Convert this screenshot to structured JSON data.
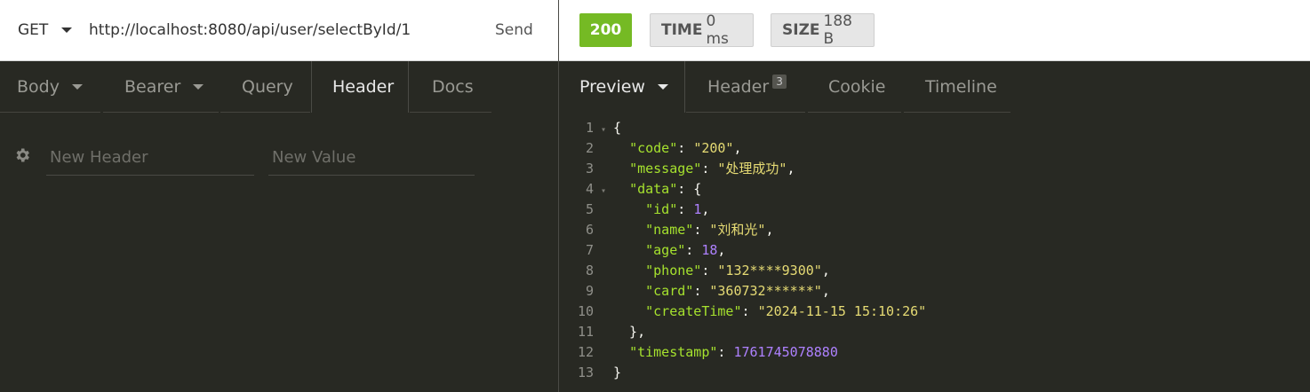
{
  "request": {
    "method": "GET",
    "url": "http://localhost:8080/api/user/selectById/1",
    "send_label": "Send"
  },
  "response_meta": {
    "status": "200",
    "time_label": "TIME",
    "time_value": "0 ms",
    "size_label": "SIZE",
    "size_value": "188 B"
  },
  "request_tabs": [
    {
      "label": "Body",
      "has_caret": true
    },
    {
      "label": "Bearer",
      "has_caret": true
    },
    {
      "label": "Query"
    },
    {
      "label": "Header",
      "active": true
    },
    {
      "label": "Docs"
    }
  ],
  "response_tabs": [
    {
      "label": "Preview",
      "has_caret": true,
      "active": true
    },
    {
      "label": "Header",
      "count": "3"
    },
    {
      "label": "Cookie"
    },
    {
      "label": "Timeline"
    }
  ],
  "header_editor": {
    "name_placeholder": "New Header",
    "value_placeholder": "New Value"
  },
  "response_body": {
    "code": "200",
    "message": "处理成功",
    "data": {
      "id": 1,
      "name": "刘和光",
      "age": 18,
      "phone": "132****9300",
      "card": "360732******",
      "createTime": "2024-11-15 15:10:26"
    },
    "timestamp": 1761745078880
  },
  "code_lines": [
    {
      "n": "1",
      "fold": true,
      "parts": [
        [
          "p",
          "{"
        ]
      ]
    },
    {
      "n": "2",
      "parts": [
        [
          "p",
          "  "
        ],
        [
          "k",
          "\"code\""
        ],
        [
          "p",
          ": "
        ],
        [
          "s",
          "\"200\""
        ],
        [
          "p",
          ","
        ]
      ]
    },
    {
      "n": "3",
      "parts": [
        [
          "p",
          "  "
        ],
        [
          "k",
          "\"message\""
        ],
        [
          "p",
          ": "
        ],
        [
          "s",
          "\"处理成功\""
        ],
        [
          "p",
          ","
        ]
      ]
    },
    {
      "n": "4",
      "fold": true,
      "parts": [
        [
          "p",
          "  "
        ],
        [
          "k",
          "\"data\""
        ],
        [
          "p",
          ": {"
        ]
      ]
    },
    {
      "n": "5",
      "parts": [
        [
          "p",
          "    "
        ],
        [
          "k",
          "\"id\""
        ],
        [
          "p",
          ": "
        ],
        [
          "n",
          "1"
        ],
        [
          "p",
          ","
        ]
      ]
    },
    {
      "n": "6",
      "parts": [
        [
          "p",
          "    "
        ],
        [
          "k",
          "\"name\""
        ],
        [
          "p",
          ": "
        ],
        [
          "s",
          "\"刘和光\""
        ],
        [
          "p",
          ","
        ]
      ]
    },
    {
      "n": "7",
      "parts": [
        [
          "p",
          "    "
        ],
        [
          "k",
          "\"age\""
        ],
        [
          "p",
          ": "
        ],
        [
          "n",
          "18"
        ],
        [
          "p",
          ","
        ]
      ]
    },
    {
      "n": "8",
      "parts": [
        [
          "p",
          "    "
        ],
        [
          "k",
          "\"phone\""
        ],
        [
          "p",
          ": "
        ],
        [
          "s",
          "\"132****9300\""
        ],
        [
          "p",
          ","
        ]
      ]
    },
    {
      "n": "9",
      "parts": [
        [
          "p",
          "    "
        ],
        [
          "k",
          "\"card\""
        ],
        [
          "p",
          ": "
        ],
        [
          "s",
          "\"360732******\""
        ],
        [
          "p",
          ","
        ]
      ]
    },
    {
      "n": "10",
      "parts": [
        [
          "p",
          "    "
        ],
        [
          "k",
          "\"createTime\""
        ],
        [
          "p",
          ": "
        ],
        [
          "s",
          "\"2024-11-15 15:10:26\""
        ]
      ]
    },
    {
      "n": "11",
      "parts": [
        [
          "p",
          "  },"
        ]
      ]
    },
    {
      "n": "12",
      "parts": [
        [
          "p",
          "  "
        ],
        [
          "k",
          "\"timestamp\""
        ],
        [
          "p",
          ": "
        ],
        [
          "n",
          "1761745078880"
        ]
      ]
    },
    {
      "n": "13",
      "parts": [
        [
          "p",
          "}"
        ]
      ]
    }
  ],
  "colors": {
    "status_ok": "#75ba24",
    "key": "#a6e22e",
    "string": "#e6db74",
    "number": "#ae81ff",
    "panel_bg": "#282923"
  },
  "icons": {
    "method_dropdown": "chevron-down-icon",
    "header_settings": "gear-icon"
  }
}
